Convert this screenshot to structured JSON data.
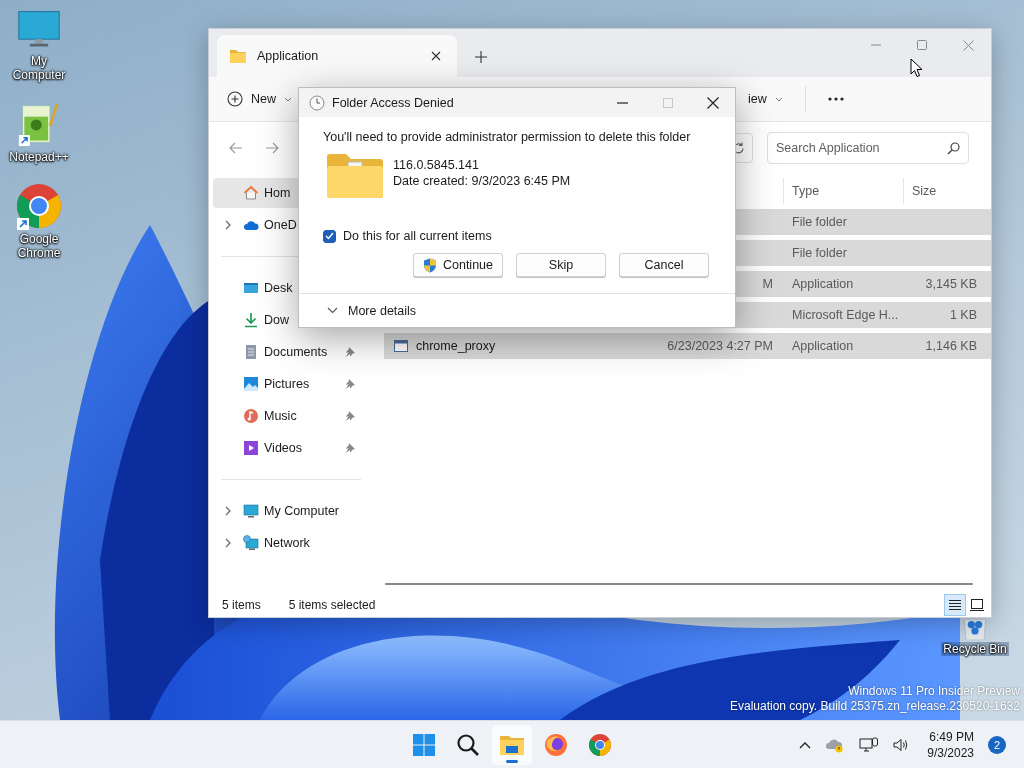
{
  "desktop_icons": [
    {
      "label": "My Computer",
      "kind": "computer",
      "shortcut": false
    },
    {
      "label": "Notepad++",
      "kind": "notepad",
      "shortcut": true
    },
    {
      "label": "Google Chrome",
      "kind": "chrome",
      "shortcut": true
    }
  ],
  "recycle_bin": {
    "label": "Recycle Bin"
  },
  "explorer": {
    "tab_title": "Application",
    "toolbar": [
      {
        "kind": "new",
        "label": "New"
      },
      {
        "kind": "view",
        "label": "iew"
      },
      {
        "kind": "more"
      }
    ],
    "search": {
      "placeholder": "Search Application"
    },
    "sidebar": [
      {
        "items": [
          {
            "label": "Hom",
            "kind": "home",
            "expandable": false,
            "pinned": false,
            "selected": true
          },
          {
            "label": "OneD",
            "kind": "cloud",
            "expandable": true,
            "pinned": false,
            "selected": false
          }
        ]
      },
      {
        "items": [
          {
            "label": "Desk",
            "kind": "desktop",
            "expandable": false,
            "pinned": false,
            "selected": false
          },
          {
            "label": "Dow",
            "kind": "download",
            "expandable": false,
            "pinned": false,
            "selected": false
          },
          {
            "label": "Documents",
            "kind": "documents",
            "expandable": false,
            "pinned": true,
            "selected": false
          },
          {
            "label": "Pictures",
            "kind": "pictures",
            "expandable": false,
            "pinned": true,
            "selected": false
          },
          {
            "label": "Music",
            "kind": "music",
            "expandable": false,
            "pinned": true,
            "selected": false
          },
          {
            "label": "Videos",
            "kind": "videos",
            "expandable": false,
            "pinned": true,
            "selected": false
          }
        ]
      },
      {
        "items": [
          {
            "label": "My Computer",
            "kind": "computer",
            "expandable": true,
            "pinned": false,
            "selected": false
          },
          {
            "label": "Network",
            "kind": "network",
            "expandable": true,
            "pinned": false,
            "selected": false
          }
        ]
      }
    ],
    "columns": [
      "Type",
      "Size"
    ],
    "rows": [
      {
        "type": "File folder",
        "selected": true
      },
      {
        "type": "File folder",
        "selected": true
      },
      {
        "date": "M",
        "type": "Application",
        "size": "3,145 KB",
        "selected": true
      },
      {
        "type": "Microsoft Edge H...",
        "size": "1 KB",
        "selected": true
      },
      {
        "name": "chrome_proxy",
        "date": "6/23/2023 4:27 PM",
        "type": "Application",
        "size": "1,146 KB",
        "selected": true
      }
    ],
    "status": {
      "count": "5 items",
      "selection": "5 items selected"
    },
    "views": [
      {
        "kind": "details",
        "selected": true
      },
      {
        "kind": "tiles",
        "selected": false
      }
    ]
  },
  "dialog": {
    "title": "Folder Access Denied",
    "controls": [
      {
        "kind": "minimize",
        "disabled": false
      },
      {
        "kind": "maximize",
        "disabled": true
      },
      {
        "kind": "close",
        "disabled": false
      }
    ],
    "message": "You'll need to provide administrator permission to delete this folder",
    "item": {
      "name": "116.0.5845.141",
      "detail": "Date created: 9/3/2023 6:45 PM"
    },
    "checkbox": {
      "label": "Do this for all current items",
      "checked": true
    },
    "buttons": [
      {
        "label": "Continue",
        "kind": "elevated"
      },
      {
        "label": "Skip",
        "kind": "plain"
      },
      {
        "label": "Cancel",
        "kind": "plain"
      }
    ],
    "details": {
      "label": "More details",
      "expanded": false
    }
  },
  "watermark": [
    "Windows 11 Pro Insider Preview",
    "Evaluation copy. Build 25375.zn_release.230520-1632"
  ],
  "taskbar": {
    "apps": [
      {
        "kind": "start",
        "active": false
      },
      {
        "kind": "search",
        "active": false
      },
      {
        "kind": "explorer",
        "active": true
      },
      {
        "kind": "firefox",
        "active": false
      },
      {
        "kind": "chrome",
        "active": false
      }
    ],
    "tray": {
      "time": "6:49 PM",
      "date": "9/3/2023",
      "notifications": "2"
    }
  }
}
